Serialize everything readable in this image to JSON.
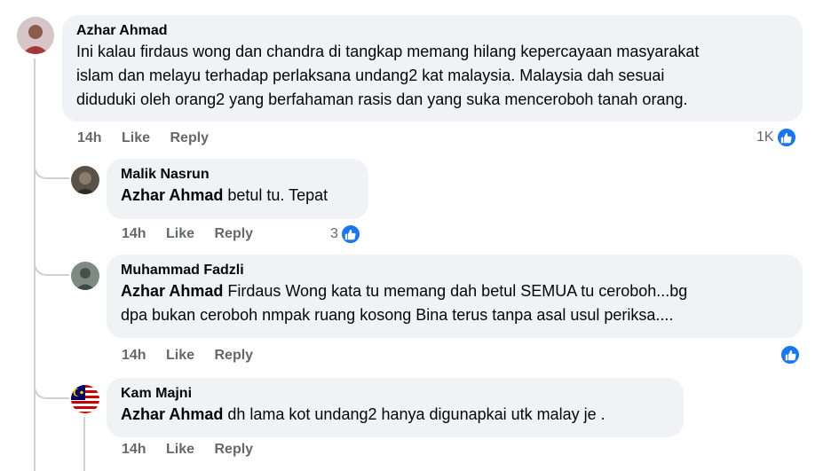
{
  "comments": [
    {
      "author": "Azhar Ahmad",
      "text_lines": [
        "Ini kalau firdaus wong dan chandra di tangkap memang hilang kepercayaan masyarakat",
        "islam dan melayu terhadap perlaksana undang2 kat malaysia. Malaysia dah sesuai",
        "diduduki oleh orang2 yang berfahaman rasis dan yang suka menceroboh tanah orang."
      ],
      "time": "14h",
      "like": "Like",
      "reply": "Reply",
      "reaction_count": "1K"
    },
    {
      "author": "Malik Nasrun",
      "mention": "Azhar Ahmad",
      "text_lines": [
        " betul tu. Tepat"
      ],
      "time": "14h",
      "like": "Like",
      "reply": "Reply",
      "reaction_count": "3"
    },
    {
      "author": "Muhammad Fadzli",
      "mention": "Azhar Ahmad",
      "text_lines": [
        " Firdaus Wong kata tu memang dah betul SEMUA tu ceroboh...bg",
        "dpa bukan ceroboh nmpak ruang kosong Bina terus tanpa asal usul periksa...."
      ],
      "time": "14h",
      "like": "Like",
      "reply": "Reply",
      "reaction_count": ""
    },
    {
      "author": "Kam Majni",
      "mention": "Azhar Ahmad",
      "text_lines": [
        " dh lama kot undang2 hanya digunapkai utk malay je ."
      ],
      "time": "14h",
      "like": "Like",
      "reply": "Reply"
    }
  ],
  "colors": {
    "bubble": "#f0f2f5",
    "like_blue": "#1877f2",
    "meta_gray": "#65676b"
  }
}
